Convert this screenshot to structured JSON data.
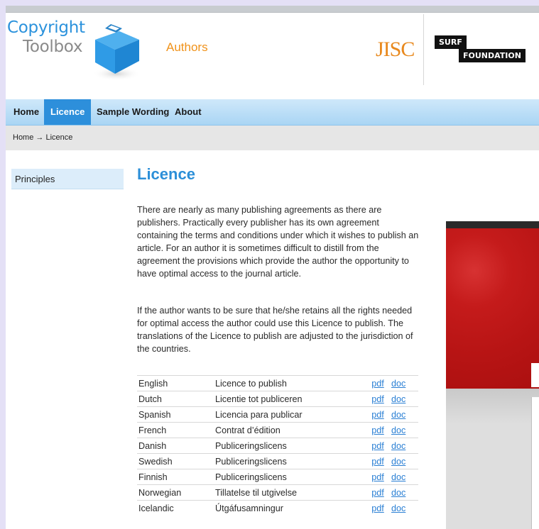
{
  "logo": {
    "line1": "Copyright",
    "line2": "Toolbox",
    "section": "Authors"
  },
  "partners": {
    "jisc": "JISC",
    "surf_line1": "SURF",
    "surf_line2": "FOUNDATION"
  },
  "nav": {
    "items": [
      {
        "label": "Home",
        "active": false
      },
      {
        "label": "Licence",
        "active": true
      },
      {
        "label": "Sample Wording",
        "active": false
      },
      {
        "label": "About",
        "active": false
      }
    ]
  },
  "breadcrumb": {
    "text": "Home → Licence"
  },
  "sidebar": {
    "items": [
      {
        "label": "Principles"
      }
    ]
  },
  "main": {
    "title": "Licence",
    "paragraph1": "There are nearly as many publishing agreements as there are publishers. Practically every publisher has its own agreement containing the terms and conditions under which it wishes to publish an article. For an author it is sometimes difficult to distill from the agreement the provisions which provide the author the opportunity to have optimal access to the journal article.",
    "paragraph2": "If the author wants to be sure that he/she retains all the rights needed for optimal access the author could use this Licence to publish. The translations of the Licence to publish are adjusted to the jurisdiction of the countries.",
    "licences": [
      {
        "language": "English",
        "title": "Licence to publish",
        "pdf": "pdf",
        "doc": "doc"
      },
      {
        "language": "Dutch",
        "title": "Licentie tot publiceren",
        "pdf": "pdf",
        "doc": "doc"
      },
      {
        "language": "Spanish",
        "title": "Licencia para publicar",
        "pdf": "pdf",
        "doc": "doc"
      },
      {
        "language": "French",
        "title": "Contrat d’édition",
        "pdf": "pdf",
        "doc": "doc"
      },
      {
        "language": "Danish",
        "title": "Publiceringslicens",
        "pdf": "pdf",
        "doc": "doc"
      },
      {
        "language": "Swedish",
        "title": "Publiceringslicens",
        "pdf": "pdf",
        "doc": "doc"
      },
      {
        "language": "Finnish",
        "title": "Publiceringslicens",
        "pdf": "pdf",
        "doc": "doc"
      },
      {
        "language": "Norwegian",
        "title": "Tillatelse til utgivelse",
        "pdf": "pdf",
        "doc": "doc"
      },
      {
        "language": "Icelandic",
        "title": "Útgáfusamningur",
        "pdf": "pdf",
        "doc": "doc"
      }
    ]
  },
  "colors": {
    "accent": "#2c8fd8",
    "nav_active": "#2d8fdb",
    "orange": "#f0921a",
    "promo_red": "#c51b1b"
  }
}
